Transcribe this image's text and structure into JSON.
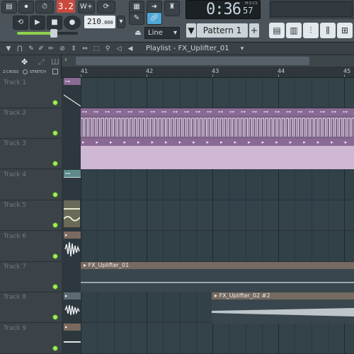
{
  "toolbar": {
    "pattern_number": "3.2",
    "bpm_main": "210",
    "bpm_frac": ".000",
    "time_main": "0:36",
    "time_sub": "57",
    "time_mode": "M:S:CS",
    "pattern_label": "Pattern 1",
    "pattern_add": "+",
    "pattern_menu": "▼",
    "snap_mode": "Line",
    "master_volume": 0.6,
    "song_mode_icon": "song-icon"
  },
  "playlist": {
    "title": "Playlist - FX_Uplifter_01",
    "header_left_labels": [
      "Z-CROSS",
      "STRETCH"
    ]
  },
  "ruler": {
    "bars": [
      "41",
      "42",
      "43",
      "44",
      "45"
    ]
  },
  "tracks": [
    {
      "name": "Track 1"
    },
    {
      "name": "Track 2"
    },
    {
      "name": "Track 3"
    },
    {
      "name": "Track 4"
    },
    {
      "name": "Track 5"
    },
    {
      "name": "Track 6"
    },
    {
      "name": "Track 7"
    },
    {
      "name": "Track 8"
    },
    {
      "name": "Track 9"
    }
  ],
  "clips": {
    "fx1": "FX_Uplifter_01",
    "fx2": "FX_Uplifter_02 #2"
  },
  "colors": {
    "accent_green": "#8fd14f",
    "clip_purple": "#8a6a94",
    "clip_pink": "#cfb8d4",
    "clip_brown": "#766a62",
    "grid_bg": "#344047"
  }
}
